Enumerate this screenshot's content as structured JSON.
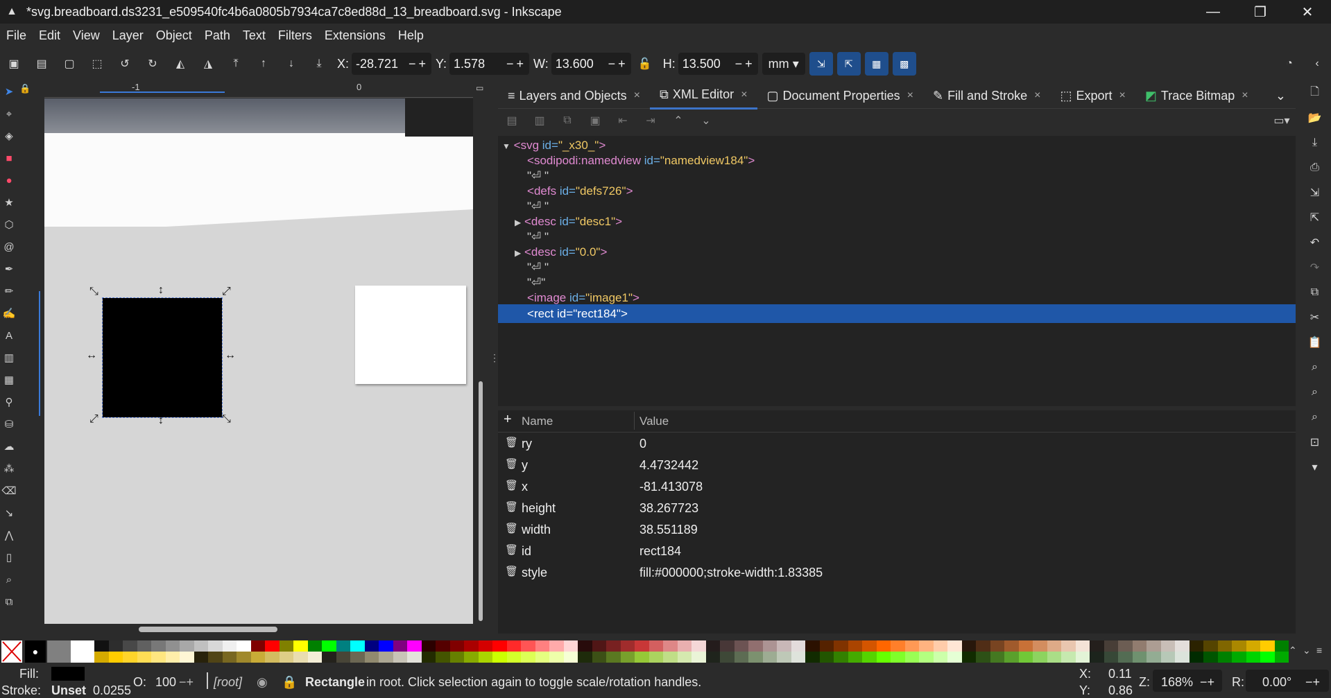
{
  "window": {
    "title": "*svg.breadboard.ds3231_e509540fc4b6a0805b7934ca7c8ed88d_13_breadboard.svg - Inkscape",
    "minimize": "—",
    "restore": "❐",
    "close": "✕"
  },
  "menu": [
    "File",
    "Edit",
    "View",
    "Layer",
    "Object",
    "Path",
    "Text",
    "Filters",
    "Extensions",
    "Help"
  ],
  "toolbar": {
    "x_label": "X:",
    "x_value": "-28.721",
    "y_label": "Y:",
    "y_value": "1.578",
    "w_label": "W:",
    "w_value": "13.600",
    "h_label": "H:",
    "h_value": "13.500",
    "units": "mm",
    "pm": "−+"
  },
  "rulers": {
    "h_tick_a": "-1",
    "h_tick_b": "0"
  },
  "dock": {
    "tabs": [
      {
        "icon": "≡",
        "label": "Layers and Objects"
      },
      {
        "icon": "⧉",
        "label": "XML Editor"
      },
      {
        "icon": "▢",
        "label": "Document Properties"
      },
      {
        "icon": "✎",
        "label": "Fill and Stroke"
      },
      {
        "icon": "⬚",
        "label": "Export"
      },
      {
        "icon": "◩",
        "label": "Trace Bitmap"
      }
    ],
    "tab_close": "×",
    "xml_nodes": [
      {
        "tag": "svg",
        "attr": "id",
        "val": "\"_x30_\""
      },
      {
        "tag": "sodipodi:namedview",
        "attr": "id",
        "val": "\"namedview184\""
      },
      {
        "text": "\"⏎    \""
      },
      {
        "tag": "defs",
        "attr": "id",
        "val": "\"defs726\""
      },
      {
        "text": "\"⏎    \""
      },
      {
        "tag": "desc",
        "attr": "id",
        "val": "\"desc1\""
      },
      {
        "text": "\"⏎    \""
      },
      {
        "tag": "desc",
        "attr": "id",
        "val": "\"0.0\""
      },
      {
        "text": "\"⏎    \""
      },
      {
        "text": "\"⏎\""
      },
      {
        "tag": "image",
        "attr": "id",
        "val": "\"image1\""
      },
      {
        "tag": "rect",
        "attr": "id",
        "val": "\"rect184\""
      }
    ],
    "attr_header": {
      "add": "+",
      "name": "Name",
      "value": "Value"
    },
    "attributes": [
      {
        "name": "ry",
        "value": "0"
      },
      {
        "name": "y",
        "value": "4.4732442"
      },
      {
        "name": "x",
        "value": "-81.413078"
      },
      {
        "name": "height",
        "value": "38.267723"
      },
      {
        "name": "width",
        "value": "38.551189"
      },
      {
        "name": "id",
        "value": "rect184"
      },
      {
        "name": "style",
        "value": "fill:#000000;stroke-width:1.83385"
      }
    ]
  },
  "status": {
    "fill_label": "Fill:",
    "stroke_label": "Stroke:",
    "stroke_value": "Unset",
    "stroke_width": "0.0255",
    "opacity_label": "O:",
    "opacity_value": "100",
    "layer": "[root]",
    "msg_bold": "Rectangle",
    "msg": " in root. Click selection again to toggle scale/rotation handles.",
    "cursor_x_label": "X:",
    "cursor_x": "0.11",
    "cursor_y_label": "Y:",
    "cursor_y": "0.86",
    "zoom_label": "Z:",
    "zoom": "168%",
    "rotate_label": "R:",
    "rotate": "0.00°"
  },
  "palette_top": [
    "#111111",
    "#2d2d2d",
    "#484848",
    "#606060",
    "#787878",
    "#909090",
    "#a8a8a8",
    "#c0c0c0",
    "#d8d8d8",
    "#f0f0f0",
    "#ffffff",
    "#800000",
    "#ff0000",
    "#808000",
    "#ffff00",
    "#008000",
    "#00ff00",
    "#008080",
    "#00ffff",
    "#000080",
    "#0000ff",
    "#800080",
    "#ff00ff",
    "#2b0000",
    "#550000",
    "#800000",
    "#aa0000",
    "#d40000",
    "#ff0000",
    "#ff2a2a",
    "#ff5555",
    "#ff8080",
    "#ffaaaa",
    "#ffd5d5",
    "#280b0b",
    "#501616",
    "#782121",
    "#a02c2c",
    "#c83737",
    "#d35f5f",
    "#de8787",
    "#e9afaf",
    "#f4d7d7",
    "#241c1c",
    "#483737",
    "#6c5353",
    "#916f6f",
    "#ac9393",
    "#c8b7b7",
    "#e3dbdb",
    "#2b1100",
    "#552200",
    "#803300",
    "#aa4400",
    "#d45500",
    "#ff6600",
    "#ff7f2a",
    "#ff9955",
    "#ffb380",
    "#ffccaa",
    "#ffe6d5",
    "#28170b",
    "#502d16",
    "#784421",
    "#a05a2c",
    "#c87137",
    "#d38d5f",
    "#deaa87",
    "#e9c6af",
    "#f4e3d7",
    "#241f1c",
    "#483e37",
    "#6c5d53",
    "#917c6f",
    "#ac9d93",
    "#c8beb7",
    "#e3dedb",
    "#2b2200",
    "#554400",
    "#806600",
    "#aa8800",
    "#d4aa00",
    "#ffcc00",
    "#008000"
  ],
  "palette_bottom": [
    "#d4aa00",
    "#ffcc00",
    "#ffd42a",
    "#ffdd55",
    "#ffe680",
    "#ffeeaa",
    "#fff6d5",
    "#28220b",
    "#504416",
    "#786721",
    "#a0892c",
    "#c8ab37",
    "#d3bc5f",
    "#decd87",
    "#e9ddaf",
    "#f4eed7",
    "#24221c",
    "#484537",
    "#6c6753",
    "#918a6f",
    "#aca793",
    "#c8c4b7",
    "#e3e2db",
    "#222b00",
    "#445500",
    "#668000",
    "#88aa00",
    "#aad400",
    "#ccff00",
    "#d4ff2a",
    "#ddff55",
    "#e5ff80",
    "#eeffaa",
    "#f6ffd5",
    "#1e2b0b",
    "#3c5016",
    "#5a7821",
    "#78a02c",
    "#96c837",
    "#abd35f",
    "#c0de87",
    "#d5e9af",
    "#eaf4d7",
    "#1f241c",
    "#3e4837",
    "#5d6c53",
    "#7c916f",
    "#9dac93",
    "#bec8b7",
    "#dee3db",
    "#112b00",
    "#225500",
    "#338000",
    "#44aa00",
    "#55d400",
    "#66ff00",
    "#7fff2a",
    "#99ff55",
    "#b3ff80",
    "#ccffaa",
    "#e5ffd5",
    "#112b00",
    "#2d5016",
    "#447821",
    "#5aa02c",
    "#71c837",
    "#8dd35f",
    "#aade87",
    "#c6e9af",
    "#e3f4d7",
    "#1c241c",
    "#374837",
    "#536c53",
    "#6f916f",
    "#93ac93",
    "#b7c8b7",
    "#dbe3db",
    "#002b00",
    "#005500",
    "#008000",
    "#00aa00",
    "#00d400",
    "#00ff00",
    "#00aa00"
  ]
}
